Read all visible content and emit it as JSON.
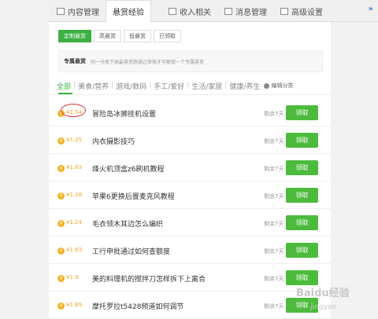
{
  "tabs": [
    {
      "label": "内容管理",
      "icon": "document-icon"
    },
    {
      "label": "悬赏经验",
      "icon": "",
      "active": true
    },
    {
      "label": "收入相关",
      "icon": "money-icon"
    },
    {
      "label": "消息管理",
      "icon": "message-icon"
    },
    {
      "label": "高级设置",
      "icon": "settings-icon"
    }
  ],
  "tab_more": "»",
  "subtabs": [
    "定制悬赏",
    "高悬赏",
    "低悬赏",
    "已领取"
  ],
  "notice": {
    "title": "专属悬赏",
    "desc": "同一分类下高最悬赏题通过审核才可解锁一个专属悬赏"
  },
  "categories": {
    "items": [
      "全部",
      "美食/营养",
      "游戏/数码",
      "手工/爱好",
      "生活/家居",
      "健康/养生"
    ],
    "edit_label": "编辑分类"
  },
  "list": [
    {
      "reward": "¥1.54",
      "title": "冒险岛冰狮挂机设置",
      "remain": "剩余7天",
      "button": "领取"
    },
    {
      "reward": "¥1.25",
      "title": "内衣摄影技巧",
      "remain": "剩余7天",
      "button": "领取"
    },
    {
      "reward": "¥1.63",
      "title": "烽火机顶盒z6刷机教程",
      "remain": "剩余7天",
      "button": "领取"
    },
    {
      "reward": "¥1.38",
      "title": "苹果6更换后置麦克风教程",
      "remain": "剩余7天",
      "button": "领取"
    },
    {
      "reward": "¥1.24",
      "title": "毛衣领木耳边怎么编织",
      "remain": "剩余7天",
      "button": "领取"
    },
    {
      "reward": "¥1.83",
      "title": "工行申批通过如何查额度",
      "remain": "剩余7天",
      "button": "领取"
    },
    {
      "reward": "¥1.9",
      "title": "美的料理机的搅拌刀怎样拆下上离合",
      "remain": "剩余7天",
      "button": "领取"
    },
    {
      "reward": "¥1.69",
      "title": "摩托罗拉t5428频道如何调节",
      "remain": "剩余7天",
      "button": "领取"
    }
  ],
  "watermark": {
    "brand": "Baidu经验",
    "sub": "jingyan"
  },
  "colors": {
    "accent": "#4cbb3c",
    "reward": "#f5a623",
    "highlight_circle": "#d9333b"
  }
}
